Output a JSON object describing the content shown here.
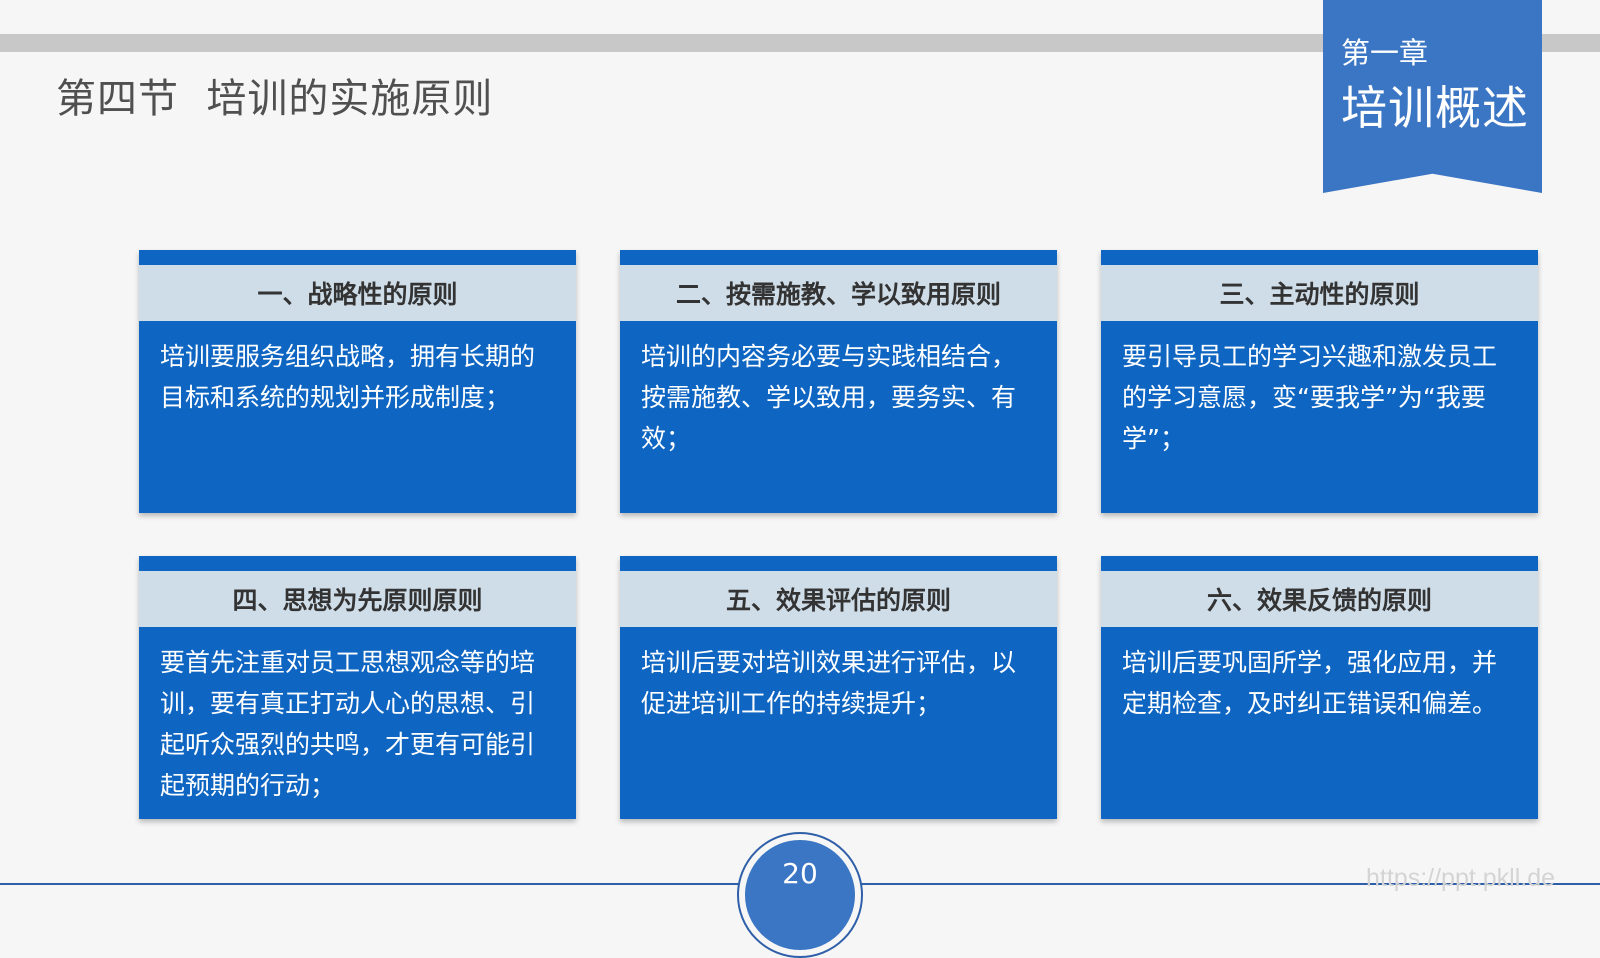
{
  "slide": {
    "section_title": "第四节  培训的实施原则",
    "chapter_number": "第一章",
    "chapter_title": "培训概述",
    "page_number": "20",
    "watermark": "https://ppt.pkll.de"
  },
  "cards": [
    {
      "title": "一、战略性的原则",
      "body": "培训要服务组织战略，拥有长期的目标和系统的规划并形成制度；"
    },
    {
      "title": "二、按需施教、学以致用原则",
      "body": "培训的内容务必要与实践相结合，按需施教、学以致用，要务实、有效；"
    },
    {
      "title": "三、主动性的原则",
      "body": "要引导员工的学习兴趣和激发员工的学习意愿，变“要我学”为“我要学”；"
    },
    {
      "title": "四、思想为先原则原则",
      "body": "要首先注重对员工思想观念等的培训，要有真正打动人心的思想、引起听众强烈的共鸣，才更有可能引起预期的行动；"
    },
    {
      "title": "五、效果评估的原则",
      "body": "培训后要对培训效果进行评估，以促进培训工作的持续提升；"
    },
    {
      "title": "六、效果反馈的原则",
      "body": "培训后要巩固所学，强化应用，并定期检查，及时纠正错误和偏差。"
    }
  ],
  "colors": {
    "card_blue": "#0f66c2",
    "header_gray_blue": "#cfdde9",
    "accent_blue": "#3b76c4"
  }
}
